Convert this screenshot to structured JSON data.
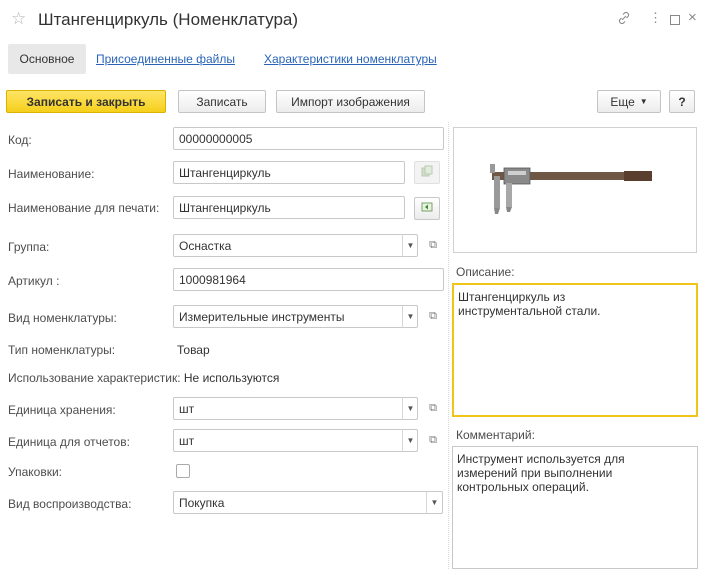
{
  "window": {
    "title": "Штангенциркуль (Номенклатура)",
    "icons": [
      "star-icon",
      "link-icon",
      "more-icon",
      "maximize-icon",
      "close-icon"
    ]
  },
  "tabs": [
    {
      "label": "Основное",
      "active": true
    },
    {
      "label": "Присоединенные файлы",
      "active": false
    },
    {
      "label": "Характеристики номенклатуры",
      "active": false
    }
  ],
  "toolbar": {
    "save_close": "Записать и закрыть",
    "save": "Записать",
    "import_image": "Импорт изображения",
    "more": "Еще",
    "help": "?"
  },
  "form": {
    "code": {
      "label": "Код:",
      "value": "00000000005"
    },
    "name": {
      "label": "Наименование:",
      "value": "Штангенциркуль"
    },
    "print_name": {
      "label": "Наименование для печати:",
      "value": "Штангенциркуль"
    },
    "group": {
      "label": "Группа:",
      "value": "Оснастка"
    },
    "article": {
      "label": "Артикул :",
      "value": "1000981964"
    },
    "nomenclature_kind": {
      "label": "Вид номенклатуры:",
      "value": "Измерительные инструменты"
    },
    "nomenclature_type": {
      "label": "Тип номенклатуры:",
      "value": "Товар"
    },
    "characteristics": {
      "label": "Использование характеристик:",
      "value": "Не используются"
    },
    "storage_unit": {
      "label": "Единица хранения:",
      "value": "шт"
    },
    "report_unit": {
      "label": "Единица для отчетов:",
      "value": "шт"
    },
    "packages": {
      "label": "Упаковки:",
      "checked": false
    },
    "reproduction": {
      "label": "Вид воспроизводства:",
      "value": "Покупка"
    }
  },
  "right": {
    "description_label": "Описание:",
    "description": "Штангенциркуль из\nинструментальной стали.",
    "comment_label": "Комментарий:",
    "comment": "Инструмент используется для\nизмерений при выполнении\nконтрольных операций."
  },
  "colors": {
    "accent_yellow": "#f5cf1b",
    "link_blue": "#2a64b8",
    "focus_border": "#f0c419"
  }
}
